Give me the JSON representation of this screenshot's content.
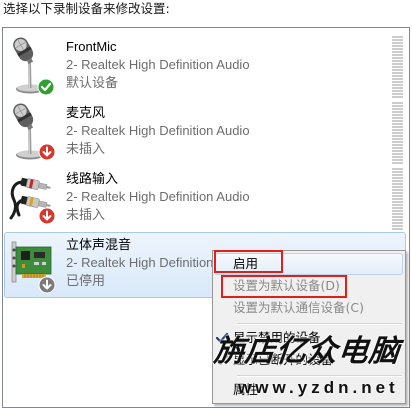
{
  "header": {
    "instruction": "选择以下录制设备来修改设置:"
  },
  "devices": [
    {
      "name": "FrontMic",
      "driver": "2- Realtek High Definition Audio",
      "status": "默认设备",
      "icon": "microphone-icon",
      "badge": "green-check-badge-icon",
      "level": 0,
      "selected": false
    },
    {
      "name": "麦克风",
      "driver": "2- Realtek High Definition Audio",
      "status": "未插入",
      "icon": "microphone-icon",
      "badge": "red-down-arrow-badge-icon",
      "level": 0,
      "selected": false
    },
    {
      "name": "线路输入",
      "driver": "2- Realtek High Definition Audio",
      "status": "未插入",
      "icon": "line-in-cable-icon",
      "badge": "red-down-arrow-badge-icon",
      "level": 0,
      "selected": false
    },
    {
      "name": "立体声混音",
      "driver": "2- Realtek High Definition Audio",
      "status": "已停用",
      "icon": "sound-card-icon",
      "badge": "gray-down-arrow-badge-icon",
      "selected": true
    }
  ],
  "context_menu": {
    "items": [
      {
        "label": "启用",
        "disabled": false,
        "highlighted": true,
        "annotated": true
      },
      {
        "label": "设置为默认设备(D)",
        "disabled": true,
        "annotated": true
      },
      {
        "label": "设置为默认通信设备(C)",
        "disabled": true
      },
      {
        "label": "显示禁用的设备",
        "checked": true
      },
      {
        "label": "显示已断开的设备",
        "checked": true
      },
      {
        "label": "属性"
      }
    ]
  },
  "watermark": {
    "text": "旃店亿众电脑",
    "url": "www.yzdn.net"
  },
  "colors": {
    "selection_bg": "#d9e9fa",
    "selection_border": "#a9c8ea",
    "secondary_text": "#6d6d6d",
    "menu_bg": "#f0f0f0",
    "menu_disabled_text": "#8a8a8a",
    "annotation_red": "#e0201b",
    "badge_default": "#2f9f2f",
    "badge_unplugged": "#d6372c",
    "badge_disabled": "#7b7b7b",
    "check_mark": "#1e3a6e"
  }
}
